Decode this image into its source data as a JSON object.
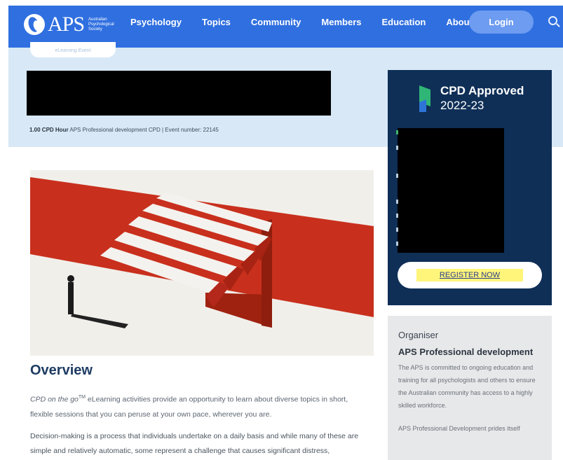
{
  "header": {
    "logo_text": "APS",
    "logo_subtitle": "Australian Psychological Society",
    "nav": [
      "Psychology",
      "Topics",
      "Community",
      "Members",
      "Education",
      "About APS"
    ],
    "login_label": "Login"
  },
  "hero": {
    "pill_label": "eLearning Event",
    "meta_bold": "1.00 CPD Hour",
    "meta_rest": " APS Professional development CPD | Event number: 22145"
  },
  "cpd_panel": {
    "title": "CPD Approved",
    "year": "2022-23",
    "register_label": "REGISTER NOW"
  },
  "main": {
    "overview_heading": "Overview",
    "para1_italic": "CPD on the go",
    "para1_tm": "TM",
    "para1_rest": " eLearning activities provide an opportunity to learn about diverse topics in short, flexible sessions that you can peruse at your own pace, wherever you are.",
    "para2": "Decision-making is a process that individuals undertake on a daily basis and while many of these are simple and relatively automatic, some represent a challenge that causes significant distress,"
  },
  "organiser": {
    "heading": "Organiser",
    "name": "APS Professional development",
    "description": "The APS is committed to ongoing education and training for all psychologists and others to ensure the Australian community has access to a highly skilled workforce.",
    "description2": "APS Professional Development prides itself"
  },
  "colors": {
    "nav_bg": "#2f6fe0",
    "hero_bg": "#d8e8f6",
    "panel_bg": "#0f2f57",
    "accent_red": "#c8301d",
    "heading_blue": "#1e3c63",
    "highlight_yellow": "#fff57a"
  },
  "icons": [
    "aps-logo-icon",
    "search-icon",
    "cpd-approved-logo-icon"
  ]
}
